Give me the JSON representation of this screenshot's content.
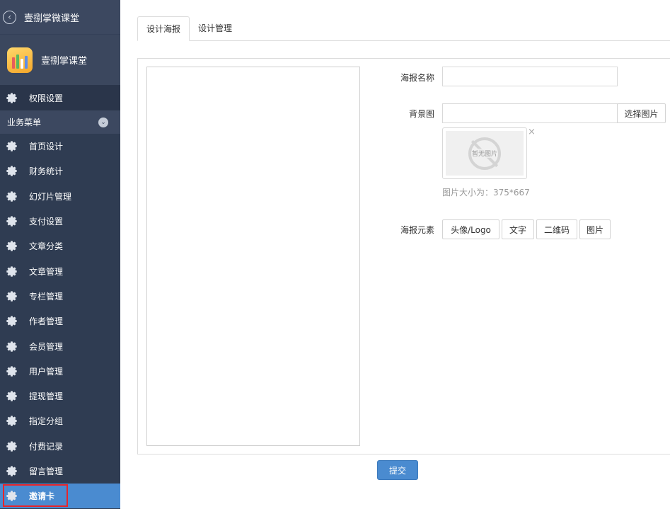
{
  "sidebar": {
    "top_title": "壹捌掌微课堂",
    "app_name": "壹捌掌课堂",
    "permission": "权限设置",
    "group": "业务菜单",
    "items": [
      "首页设计",
      "财务统计",
      "幻灯片管理",
      "支付设置",
      "文章分类",
      "文章管理",
      "专栏管理",
      "作者管理",
      "会员管理",
      "用户管理",
      "提现管理",
      "指定分组",
      "付费记录",
      "留言管理",
      "邀请卡"
    ],
    "active_item": "邀请卡",
    "accent_color": "#4a8bd0",
    "bg_color": "#2f3c52"
  },
  "tabs": [
    "设计海报",
    "设计管理"
  ],
  "form": {
    "name_label": "海报名称",
    "name_value": "",
    "bg_label": "背景图",
    "bg_value": "",
    "choose_button": "选择图片",
    "no_image_text": "暂无图片",
    "close_symbol": "×",
    "size_hint": "图片大小为：375*667",
    "elements_label": "海报元素",
    "element_buttons": [
      "头像/Logo",
      "文字",
      "二维码",
      "图片"
    ]
  },
  "submit_label": "提交",
  "icons": {
    "back": "chevron-left-circle-icon",
    "menu": "gear-icon",
    "group_toggle": "chevron-down-circle-icon",
    "placeholder": "no-image-icon"
  }
}
